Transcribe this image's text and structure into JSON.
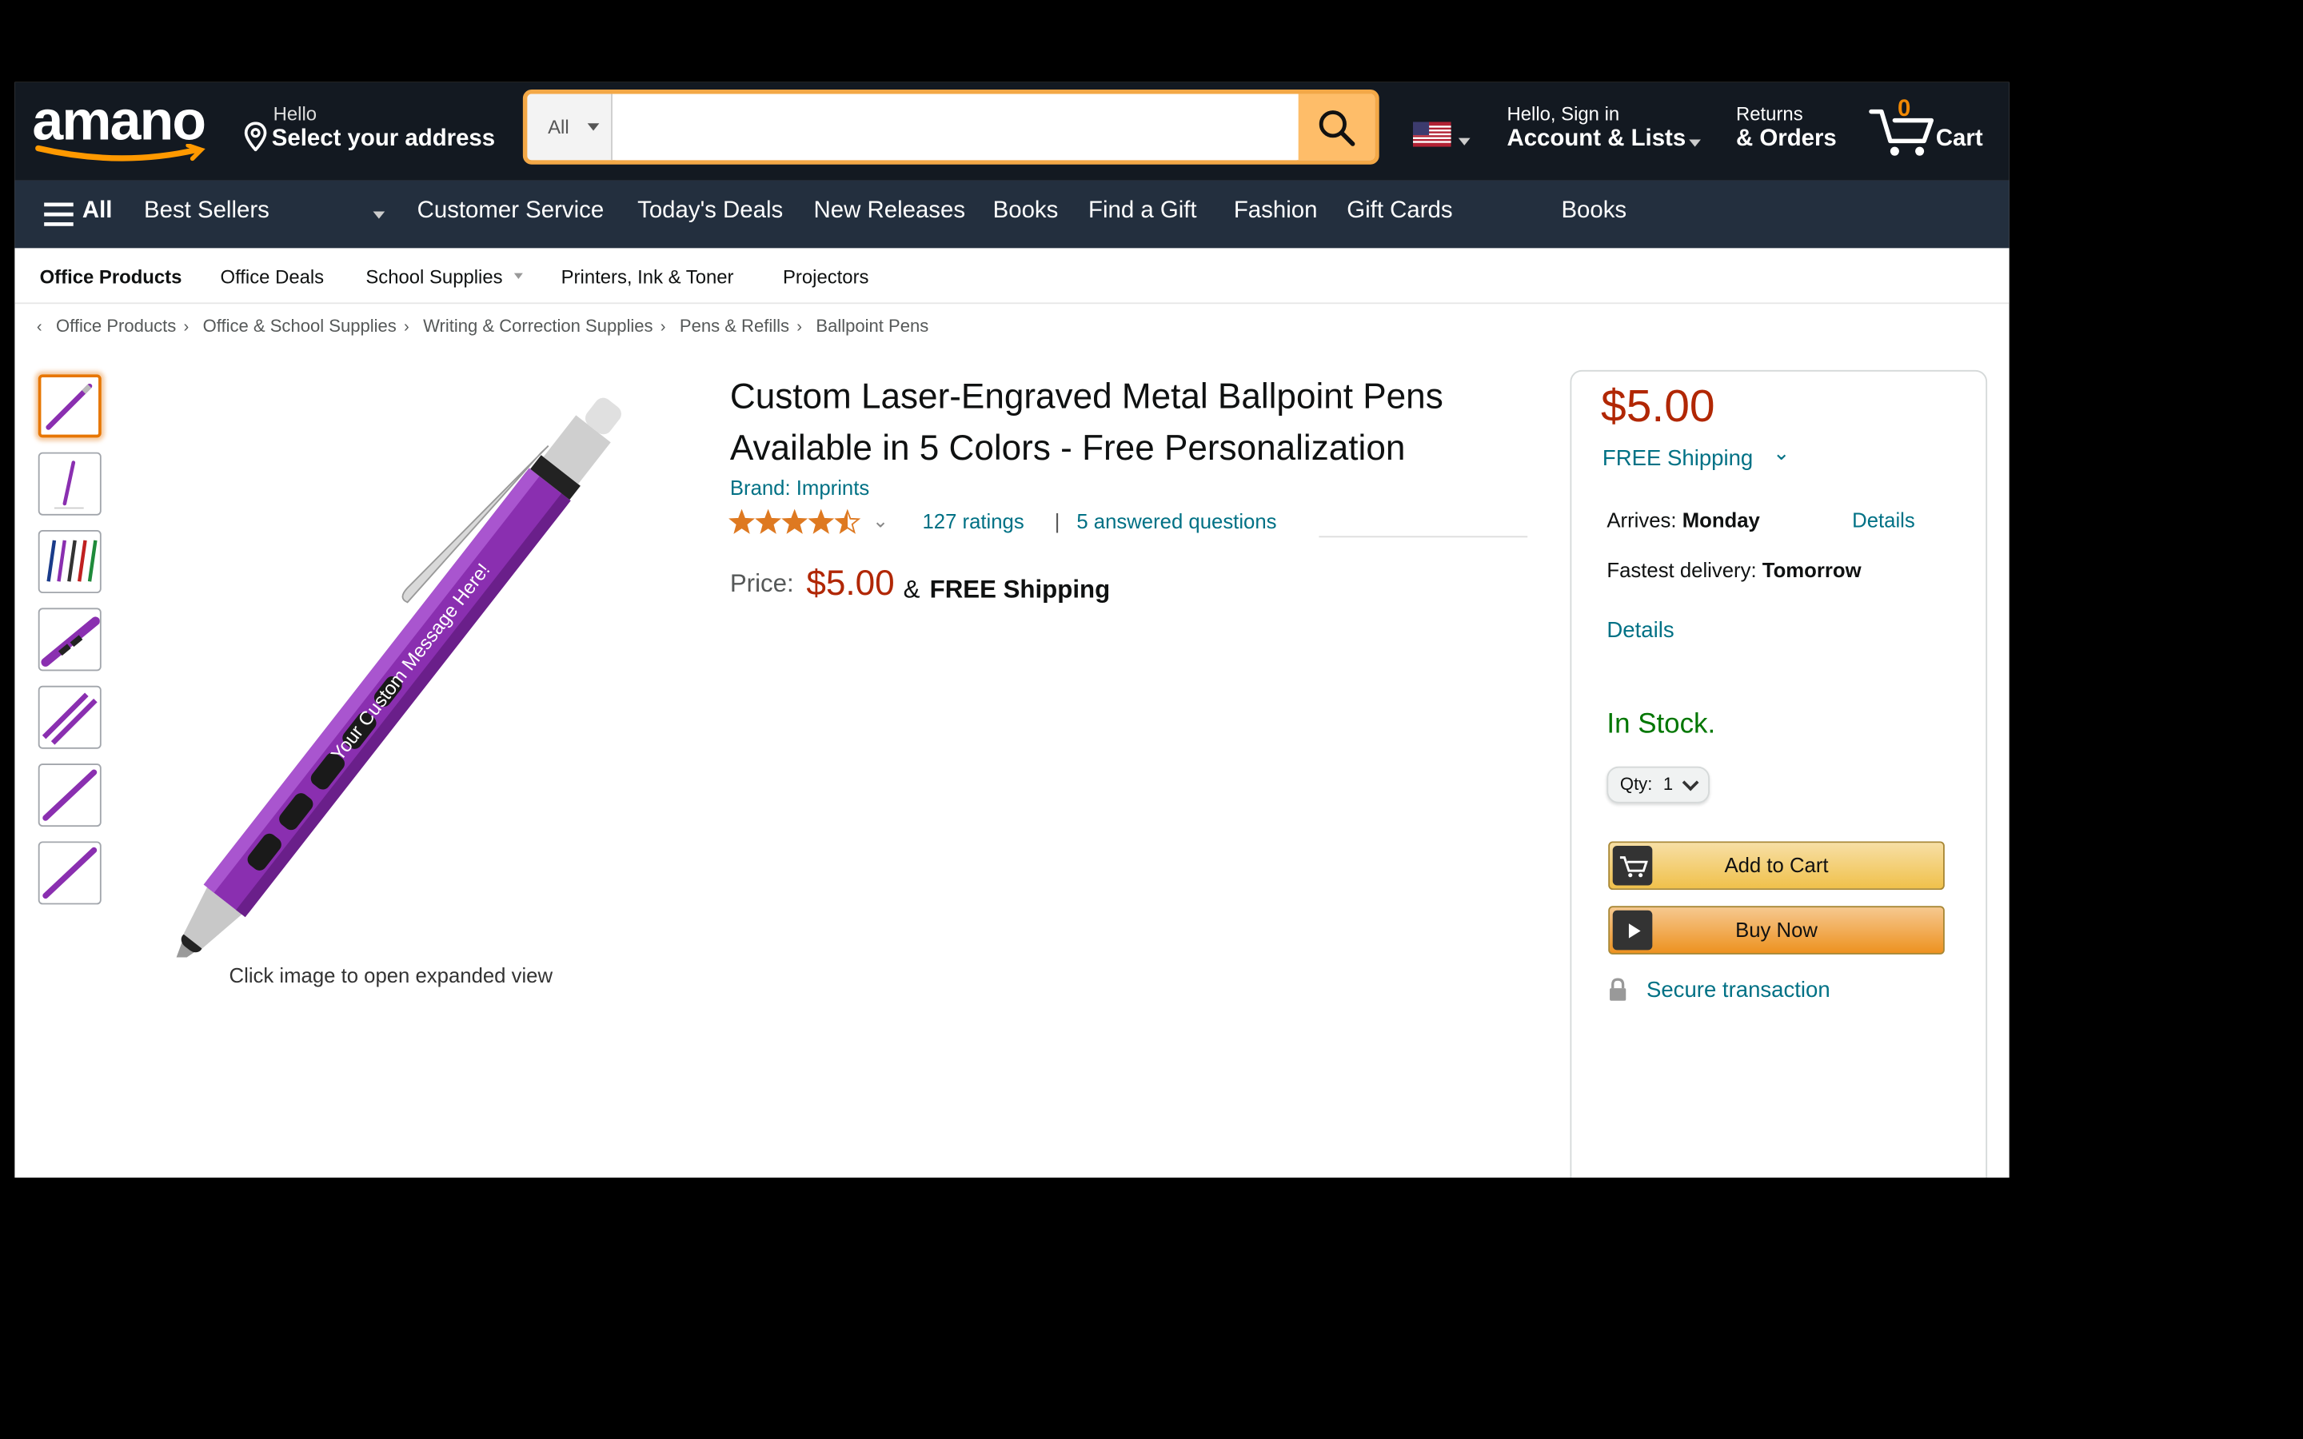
{
  "header": {
    "logo": "amano",
    "deliver_line1": "Hello",
    "deliver_line2": "Select your address",
    "search_category": "All",
    "search_placeholder": "",
    "account_line1": "Hello, Sign in",
    "account_line2": "Account & Lists",
    "returns_line1": "Returns",
    "returns_line2": "& Orders",
    "cart_count": "0",
    "cart_label": "Cart"
  },
  "nav": {
    "all_label": "All",
    "items": [
      "Best Sellers",
      "Customer Service",
      "Today's Deals",
      "New Releases",
      "Books",
      "Find a Gift",
      "Fashion",
      "Gift Cards",
      "Books"
    ]
  },
  "subnav": {
    "items": [
      "Office Products",
      "Office Deals",
      "School Supplies",
      "Printers, Ink & Toner",
      "Projectors"
    ]
  },
  "breadcrumb": [
    "Office Products",
    "Office & School Supplies",
    "Writing & Correction Supplies",
    "Pens & Refills",
    "Ballpoint Pens"
  ],
  "gallery": {
    "engraving_text": "Your Custom Message Here!",
    "caption": "Click image to open expanded view",
    "pen_color": "#8a2fb0"
  },
  "product": {
    "title_line1": "Custom Laser-Engraved Metal Ballpoint Pens",
    "title_line2": "Available in 5 Colors - Free Personalization",
    "brand": "Brand: Imprints",
    "rating_stars": 4.5,
    "ratings": "127 ratings",
    "separator": "|",
    "answered": "5 answered questions",
    "price_label": "Price:",
    "price": "$5.00",
    "amp": "&",
    "shipping": "FREE Shipping"
  },
  "buybox": {
    "price": "$5.00",
    "shipping": "FREE Shipping",
    "arrives_label": "Arrives:",
    "arrives_day": "Monday",
    "details1": "Details",
    "fastest_label": "Fastest delivery:",
    "fastest_day": "Tomorrow",
    "details2": "Details",
    "stock": "In Stock.",
    "qty_label": "Qty:",
    "qty_value": "1",
    "add_to_cart": "Add to Cart",
    "buy_now": "Buy Now",
    "secure": "Secure transaction"
  },
  "colors": {
    "header_bg": "#131921",
    "nav_bg": "#232f3e",
    "search_button": "#febd69",
    "price_red": "#b12704",
    "link": "#007185",
    "in_stock": "#007600",
    "star": "#de7921",
    "add_to_cart": "#ffd814",
    "buy_now": "#ffa41c"
  }
}
